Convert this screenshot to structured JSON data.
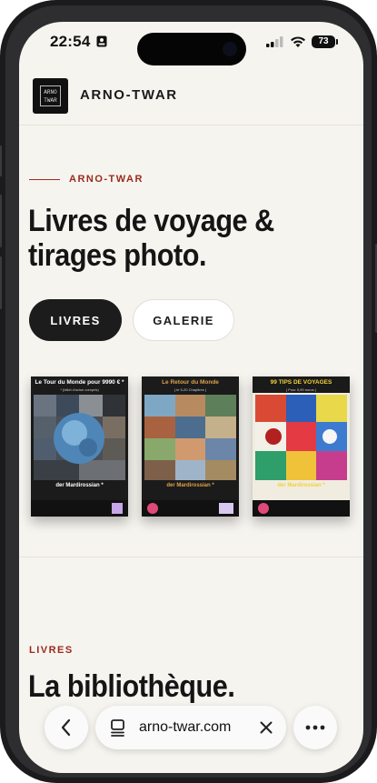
{
  "status_bar": {
    "time": "22:54",
    "battery": "73"
  },
  "header": {
    "logo_text": "ARNO TWAR",
    "brand": "ARNO-TWAR"
  },
  "hero": {
    "kicker": "ARNO-TWAR",
    "title": "Livres de voyage & tirages photo."
  },
  "tabs": [
    {
      "label": "LIVRES",
      "active": true
    },
    {
      "label": "GALERIE",
      "active": false
    }
  ],
  "books": [
    {
      "title": "Le Tour du Monde pour 9990 € *",
      "subtitle": "* (billet d'avion compris)",
      "author": "der Mardirossian *"
    },
    {
      "title": "Le Retour du Monde",
      "subtitle": "( le 5-20 Chapitres )",
      "author": "der Mardirossian *"
    },
    {
      "title": "99 TIPS DE VOYAGES",
      "subtitle": "( Pour 5,99 euros )",
      "author": "der Mardirossian *"
    }
  ],
  "section": {
    "kicker": "LIVRES",
    "title": "La bibliothèque."
  },
  "browser": {
    "url": "arno-twar.com"
  },
  "colors": {
    "accent": "#9a2a1d",
    "ink": "#151515",
    "page_bg": "#f6f4ef"
  }
}
